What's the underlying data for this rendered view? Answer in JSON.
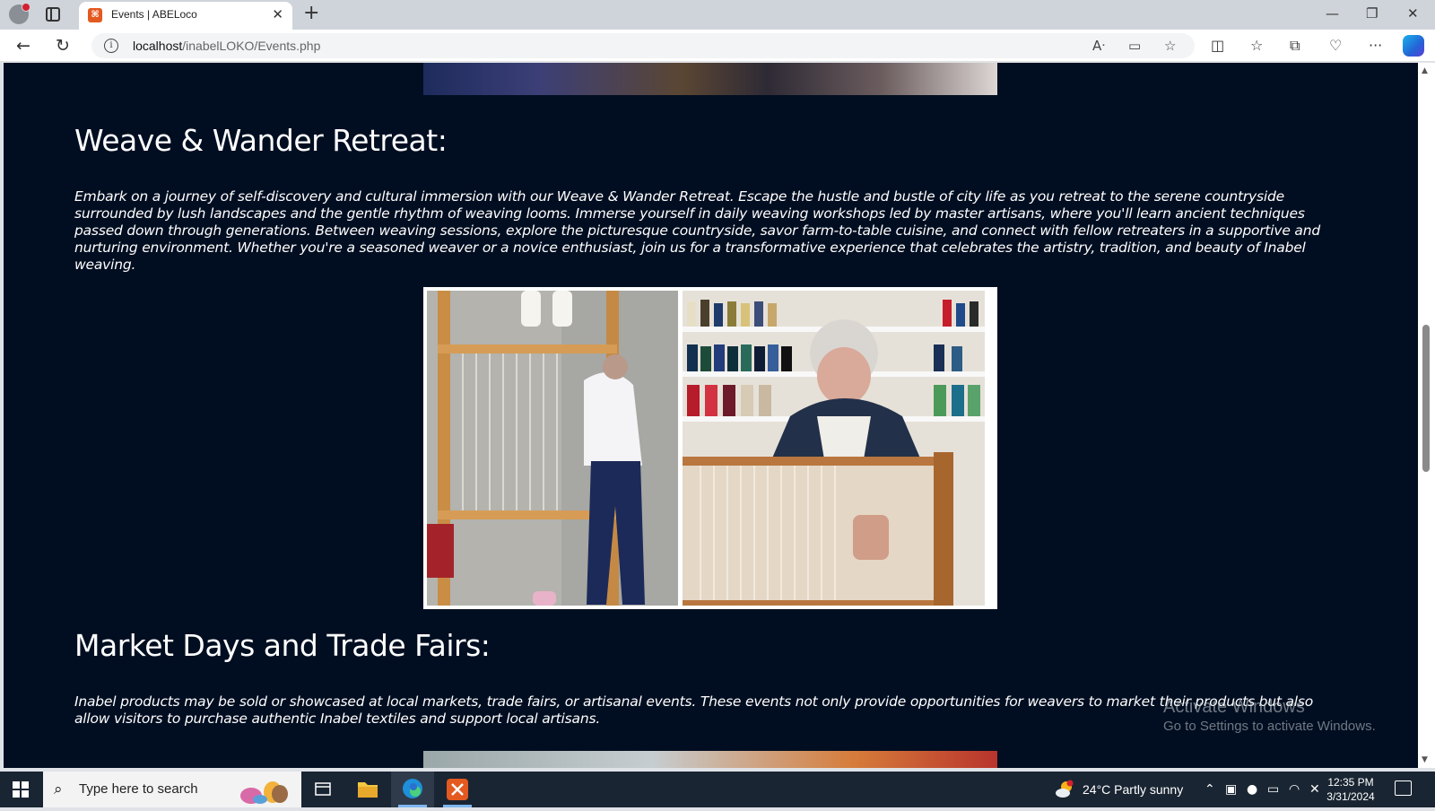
{
  "browser": {
    "tab_title": "Events | ABELoco",
    "tab_favicon": "ABELoco-logo-icon",
    "url_host": "localhost",
    "url_path": "/inabelLOKO/Events.php"
  },
  "page": {
    "sections": [
      {
        "title": "Weave & Wander Retreat:",
        "description": "Embark on a journey of self-discovery and cultural immersion with our Weave & Wander Retreat. Escape the hustle and bustle of city life as you retreat to the serene countryside surrounded by lush landscapes and the gentle rhythm of weaving looms. Immerse yourself in daily weaving workshops led by master artisans, where you'll learn ancient techniques passed down through generations. Between weaving sessions, explore the picturesque countryside, savor farm-to-table cuisine, and connect with fellow retreaters in a supportive and nurturing environment. Whether you're a seasoned weaver or a novice enthusiast, join us for a transformative experience that celebrates the artistry, tradition, and beauty of Inabel weaving."
      },
      {
        "title": "Market Days and Trade Fairs:",
        "description": "Inabel products may be sold or showcased at local markets, trade fairs, or artisanal events. These events not only provide opportunities for weavers to market their products but also allow visitors to purchase authentic Inabel textiles and support local artisans."
      }
    ]
  },
  "watermark": {
    "title": "Activate Windows",
    "subtitle": "Go to Settings to activate Windows."
  },
  "taskbar": {
    "search_placeholder": "Type here to search",
    "weather": "24°C  Partly sunny",
    "time": "12:35 PM",
    "date": "3/31/2024"
  },
  "colors": {
    "page_background": "#010e21",
    "taskbar": "#1a2533",
    "favicon": "#e3591f"
  }
}
